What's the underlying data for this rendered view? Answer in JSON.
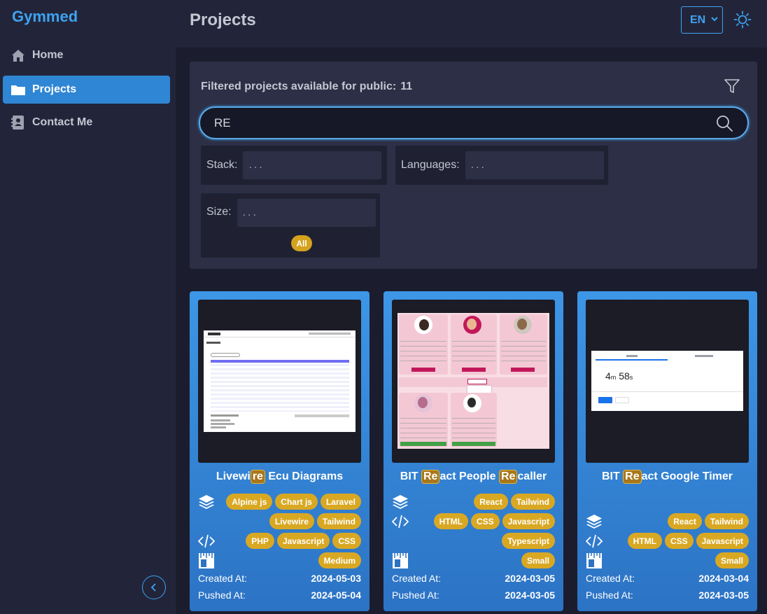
{
  "sidebar": {
    "brand": "Gymmed",
    "items": [
      {
        "label": "Home"
      },
      {
        "label": "Projects"
      },
      {
        "label": "Contact Me"
      }
    ]
  },
  "header": {
    "title": "Projects",
    "language": "EN"
  },
  "filters": {
    "count_label": "Filtered projects available for public:",
    "count": "11",
    "search_value": "RE",
    "stack_label": "Stack:",
    "stack_placeholder": "...",
    "languages_label": "Languages:",
    "languages_placeholder": "...",
    "size_label": "Size:",
    "size_placeholder": "...",
    "size_badge": "All"
  },
  "cards": [
    {
      "title_pre": "Livewi",
      "title_hl1": "re",
      "title_mid": " Ecu Diagrams",
      "title_hl2": "",
      "title_post": "",
      "stack_tags": [
        "Alpine js",
        "Chart js",
        "Laravel",
        "Livewire",
        "Tailwind"
      ],
      "lang_tags": [
        "PHP",
        "Javascript",
        "CSS"
      ],
      "size": "Medium",
      "created_label": "Created At:",
      "created": "2024-05-03",
      "pushed_label": "Pushed At:",
      "pushed": "2024-05-04"
    },
    {
      "title_pre": "BIT ",
      "title_hl1": "Re",
      "title_mid": "act People ",
      "title_hl2": "Re",
      "title_post": "caller",
      "stack_tags": [
        "React",
        "Tailwind"
      ],
      "lang_tags": [
        "HTML",
        "CSS",
        "Javascript",
        "Typescript"
      ],
      "size": "Small",
      "created_label": "Created At:",
      "created": "2024-03-05",
      "pushed_label": "Pushed At:",
      "pushed": "2024-03-05"
    },
    {
      "title_pre": "BIT ",
      "title_hl1": "Re",
      "title_mid": "act Google Timer",
      "title_hl2": "",
      "title_post": "",
      "stack_tags": [
        "React",
        "Tailwind"
      ],
      "lang_tags": [
        "HTML",
        "CSS",
        "Javascript"
      ],
      "size": "Small",
      "created_label": "Created At:",
      "created": "2024-03-04",
      "pushed_label": "Pushed At:",
      "pushed": "2024-03-05"
    }
  ],
  "thumbnails": {
    "timer_minutes": "4",
    "timer_m": "m",
    "timer_seconds": "58",
    "timer_s": "s"
  },
  "colors": {
    "accent": "#3ea2f0",
    "tag": "#d9a823",
    "highlight": "#a8771a"
  }
}
